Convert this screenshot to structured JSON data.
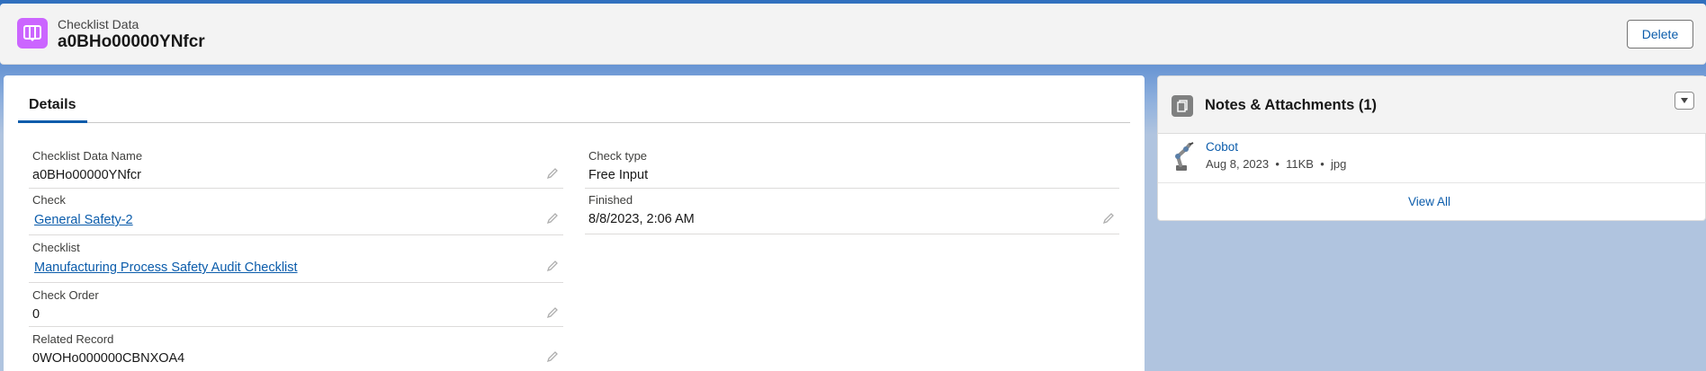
{
  "header": {
    "object_label": "Checklist Data",
    "record_name": "a0BHo00000YNfcr",
    "delete_label": "Delete"
  },
  "details": {
    "tab_label": "Details",
    "left_fields": [
      {
        "label": "Checklist Data Name",
        "value": "a0BHo00000YNfcr"
      },
      {
        "label": "Check",
        "value": "General Safety-2"
      },
      {
        "label": "Checklist",
        "value": "Manufacturing Process Safety Audit Checklist"
      },
      {
        "label": "Check Order",
        "value": "0"
      },
      {
        "label": "Related Record",
        "value": "0WOHo000000CBNXOA4"
      }
    ],
    "right_fields": [
      {
        "label": "Check type",
        "value": "Free Input"
      },
      {
        "label": "Finished",
        "value": "8/8/2023, 2:06 AM"
      }
    ]
  },
  "notes": {
    "title": "Notes & Attachments (1)",
    "file": {
      "name": "Cobot",
      "date": "Aug 8, 2023",
      "size": "11KB",
      "ext": "jpg"
    },
    "view_all_label": "View All"
  },
  "colors": {
    "accent": "#0b5cab",
    "object_icon": "#cb65ff",
    "notes_icon": "#7f8080"
  }
}
